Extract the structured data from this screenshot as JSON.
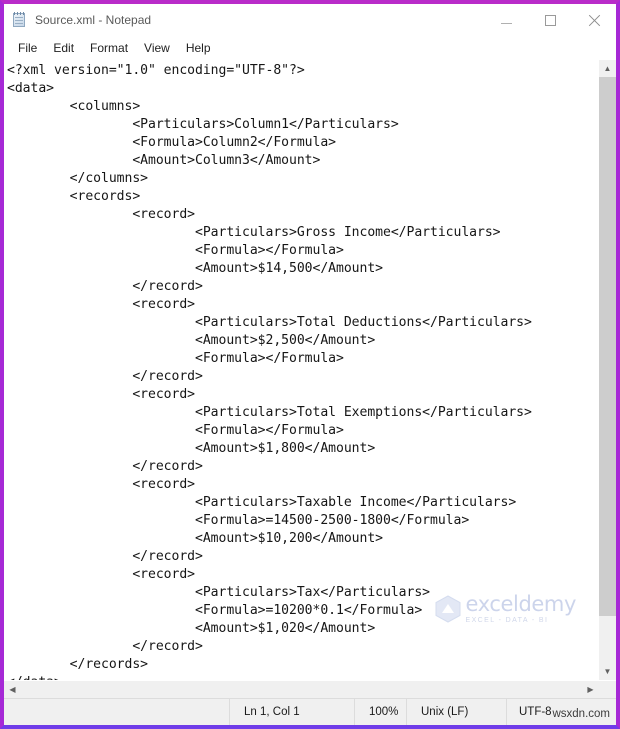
{
  "window": {
    "title": "Source.xml - Notepad",
    "icon": "notepad-icon",
    "controls": {
      "minimize": "minimize-icon",
      "maximize": "maximize-icon",
      "close": "close-icon"
    },
    "frame_color": "#a629d6"
  },
  "menubar": {
    "items": [
      {
        "label": "File"
      },
      {
        "label": "Edit"
      },
      {
        "label": "Format"
      },
      {
        "label": "View"
      },
      {
        "label": "Help"
      }
    ]
  },
  "editor": {
    "content": "<?xml version=\"1.0\" encoding=\"UTF-8\"?>\n<data>\n\t<columns>\n\t\t<Particulars>Column1</Particulars>\n\t\t<Formula>Column2</Formula>\n\t\t<Amount>Column3</Amount>\n\t</columns>\n\t<records>\n\t\t<record>\n\t\t\t<Particulars>Gross Income</Particulars>\n\t\t\t<Formula></Formula>\n\t\t\t<Amount>$14,500</Amount>\n\t\t</record>\n\t\t<record>\n\t\t\t<Particulars>Total Deductions</Particulars>\n\t\t\t<Amount>$2,500</Amount>\n\t\t\t<Formula></Formula>\n\t\t</record>\n\t\t<record>\n\t\t\t<Particulars>Total Exemptions</Particulars>\n\t\t\t<Formula></Formula>\n\t\t\t<Amount>$1,800</Amount>\n\t\t</record>\n\t\t<record>\n\t\t\t<Particulars>Taxable Income</Particulars>\n\t\t\t<Formula>=14500-2500-1800</Formula>\n\t\t\t<Amount>$10,200</Amount>\n\t\t</record>\n\t\t<record>\n\t\t\t<Particulars>Tax</Particulars>\n\t\t\t<Formula>=10200*0.1</Formula>\n\t\t\t<Amount>$1,020</Amount>\n\t\t</record>\n\t</records>\n</data>",
    "scrollbars": {
      "vertical_up": "chevron-up-icon",
      "vertical_down": "chevron-down-icon",
      "horizontal_left": "chevron-left-icon",
      "horizontal_right": "chevron-right-icon"
    }
  },
  "statusbar": {
    "cursor_position": "Ln 1, Col 1",
    "zoom": "100%",
    "line_ending": "Unix (LF)",
    "encoding": "UTF-8"
  },
  "watermarks": {
    "brand_name": "exceldemy",
    "brand_tagline": "EXCEL - DATA - BI",
    "site": "wsxdn.com"
  }
}
